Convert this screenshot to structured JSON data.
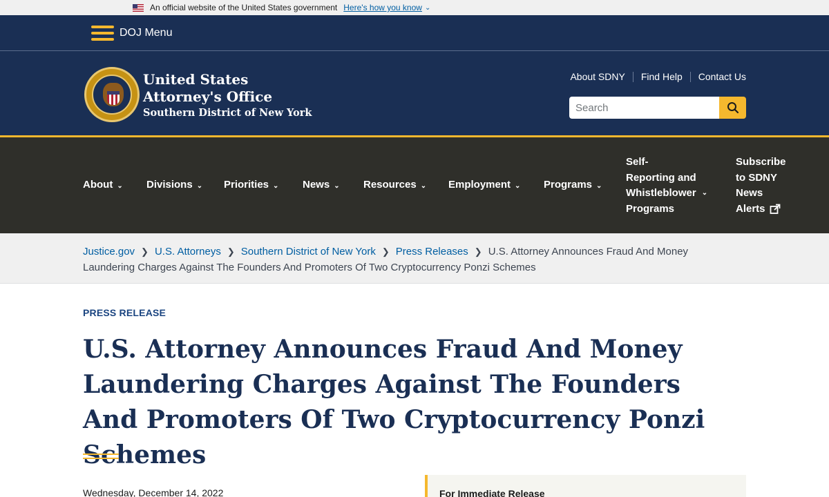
{
  "gov_banner": {
    "text": "An official website of the United States government",
    "link": "Here's how you know"
  },
  "doj_bar": {
    "menu_label": "DOJ Menu"
  },
  "header": {
    "office_line1": "United States",
    "office_line2": "Attorney's Office",
    "office_line3": "Southern District of New York",
    "seal_text": "DEPARTMENT OF JUSTICE",
    "utility_links": [
      "About SDNY",
      "Find Help",
      "Contact Us"
    ],
    "search_placeholder": "Search"
  },
  "nav": {
    "items": [
      "About",
      "Divisions",
      "Priorities",
      "News",
      "Resources",
      "Employment",
      "Programs"
    ],
    "self_reporting": [
      "Self-",
      "Reporting and",
      "Whistleblower",
      "Programs"
    ],
    "subscribe": [
      "Subscribe",
      "to SDNY",
      "News",
      "Alerts"
    ]
  },
  "breadcrumb": {
    "items": [
      "Justice.gov",
      "U.S. Attorneys",
      "Southern District of New York",
      "Press Releases"
    ],
    "current": "U.S. Attorney Announces Fraud And Money Laundering Charges Against The Founders And Promoters Of Two Cryptocurrency Ponzi Schemes"
  },
  "article": {
    "eyebrow": "PRESS RELEASE",
    "headline": "U.S. Attorney Announces Fraud And Money Laundering Charges Against The Founders And Promoters Of Two Cryptocurrency Ponzi Schemes",
    "date": "Wednesday, December 14, 2022",
    "release_label": "For Immediate Release"
  },
  "colors": {
    "navy": "#1a2f54",
    "gold": "#f5b82e",
    "nav_bg": "#2f2f2a",
    "link": "#005ea2"
  }
}
